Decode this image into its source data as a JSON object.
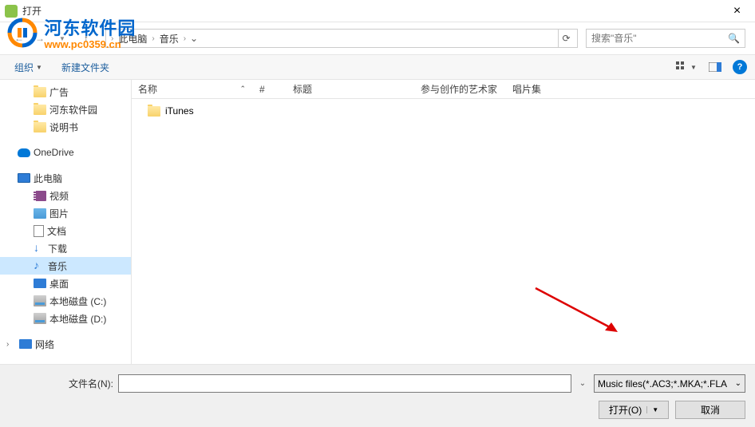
{
  "window": {
    "title": "打开"
  },
  "watermark": {
    "text": "河东软件园",
    "url": "www.pc0359.cn"
  },
  "breadcrumb": {
    "items": [
      "此电脑",
      "音乐"
    ]
  },
  "search": {
    "placeholder": "搜索\"音乐\""
  },
  "toolbar": {
    "organize": "组织",
    "new_folder": "新建文件夹"
  },
  "columns": {
    "name": "名称",
    "num": "#",
    "title": "标题",
    "artist": "参与创作的艺术家",
    "album": "唱片集"
  },
  "sidebar": {
    "items": [
      {
        "label": "广告",
        "type": "folder",
        "sub": true
      },
      {
        "label": "河东软件园",
        "type": "folder",
        "sub": true
      },
      {
        "label": "说明书",
        "type": "folder",
        "sub": true
      },
      {
        "label": "OneDrive",
        "type": "onedrive",
        "sub": false,
        "spacer_before": true
      },
      {
        "label": "此电脑",
        "type": "pc",
        "sub": false,
        "spacer_before": true
      },
      {
        "label": "视频",
        "type": "video",
        "sub": true
      },
      {
        "label": "图片",
        "type": "pic",
        "sub": true
      },
      {
        "label": "文档",
        "type": "doc",
        "sub": true
      },
      {
        "label": "下载",
        "type": "download",
        "sub": true
      },
      {
        "label": "音乐",
        "type": "music",
        "sub": true,
        "selected": true
      },
      {
        "label": "桌面",
        "type": "desktop",
        "sub": true
      },
      {
        "label": "本地磁盘 (C:)",
        "type": "disk",
        "sub": true
      },
      {
        "label": "本地磁盘 (D:)",
        "type": "disk",
        "sub": true
      },
      {
        "label": "网络",
        "type": "network",
        "sub": false,
        "spacer_before": true,
        "expand": true
      }
    ]
  },
  "files": [
    {
      "name": "iTunes",
      "type": "folder"
    }
  ],
  "bottom": {
    "filename_label": "文件名(N):",
    "filter": "Music files(*.AC3;*.MKA;*.FLA",
    "open": "打开(O)",
    "cancel": "取消"
  }
}
